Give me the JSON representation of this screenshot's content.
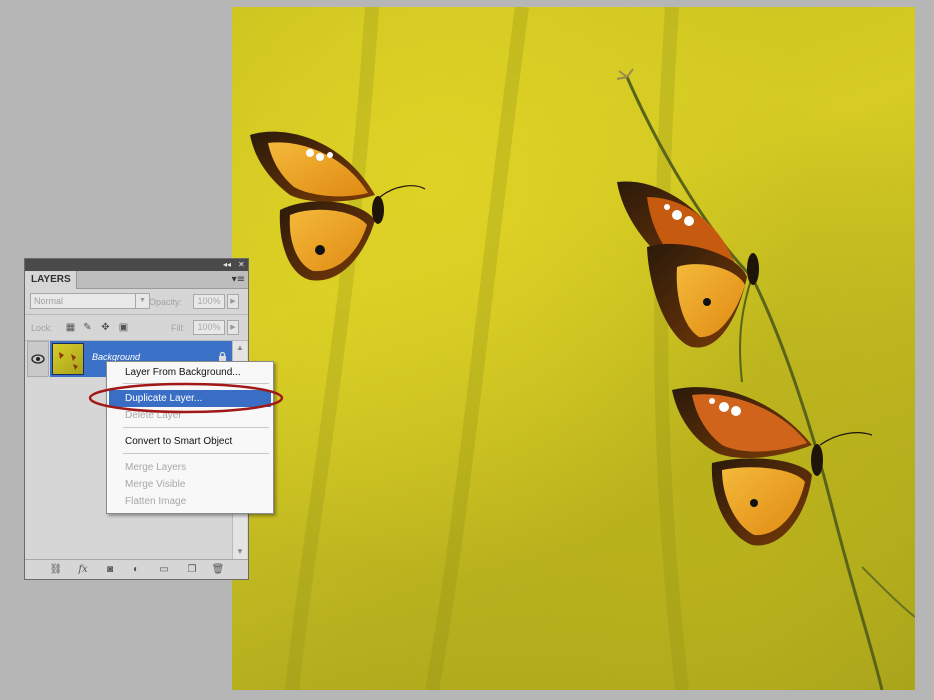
{
  "panel": {
    "collapse_label": "◂◂",
    "close_label": "✕",
    "tab_label": "LAYERS",
    "menu_label": "▾≡",
    "blend_mode": "Normal",
    "opacity_label": "Opacity:",
    "opacity_value": "100%",
    "lock_label": "Lock:",
    "fill_label": "Fill:",
    "fill_value": "100%"
  },
  "layers": [
    {
      "name": "Background",
      "visible": true,
      "locked": true,
      "selected": true
    }
  ],
  "context_menu": {
    "items": [
      {
        "label": "Layer From Background...",
        "enabled": true,
        "highlighted": false
      },
      {
        "label": "Duplicate Layer...",
        "enabled": true,
        "highlighted": true
      },
      {
        "label": "Delete Layer",
        "enabled": false,
        "highlighted": false
      },
      {
        "label": "Convert to Smart Object",
        "enabled": true,
        "highlighted": false
      },
      {
        "label": "Merge Layers",
        "enabled": false,
        "highlighted": false
      },
      {
        "label": "Merge Visible",
        "enabled": false,
        "highlighted": false
      },
      {
        "label": "Flatten Image",
        "enabled": false,
        "highlighted": false
      }
    ]
  },
  "bottom_toolbar": {
    "icons": [
      "link-layers-icon",
      "fx-icon",
      "layer-mask-icon",
      "adjustment-layer-icon",
      "new-group-icon",
      "new-layer-icon",
      "trash-icon"
    ],
    "fx_label": "fx"
  },
  "colors": {
    "selection_blue": "#3b72c8",
    "menu_highlight": "#3a6ec4",
    "annotation_red": "#a01818"
  }
}
